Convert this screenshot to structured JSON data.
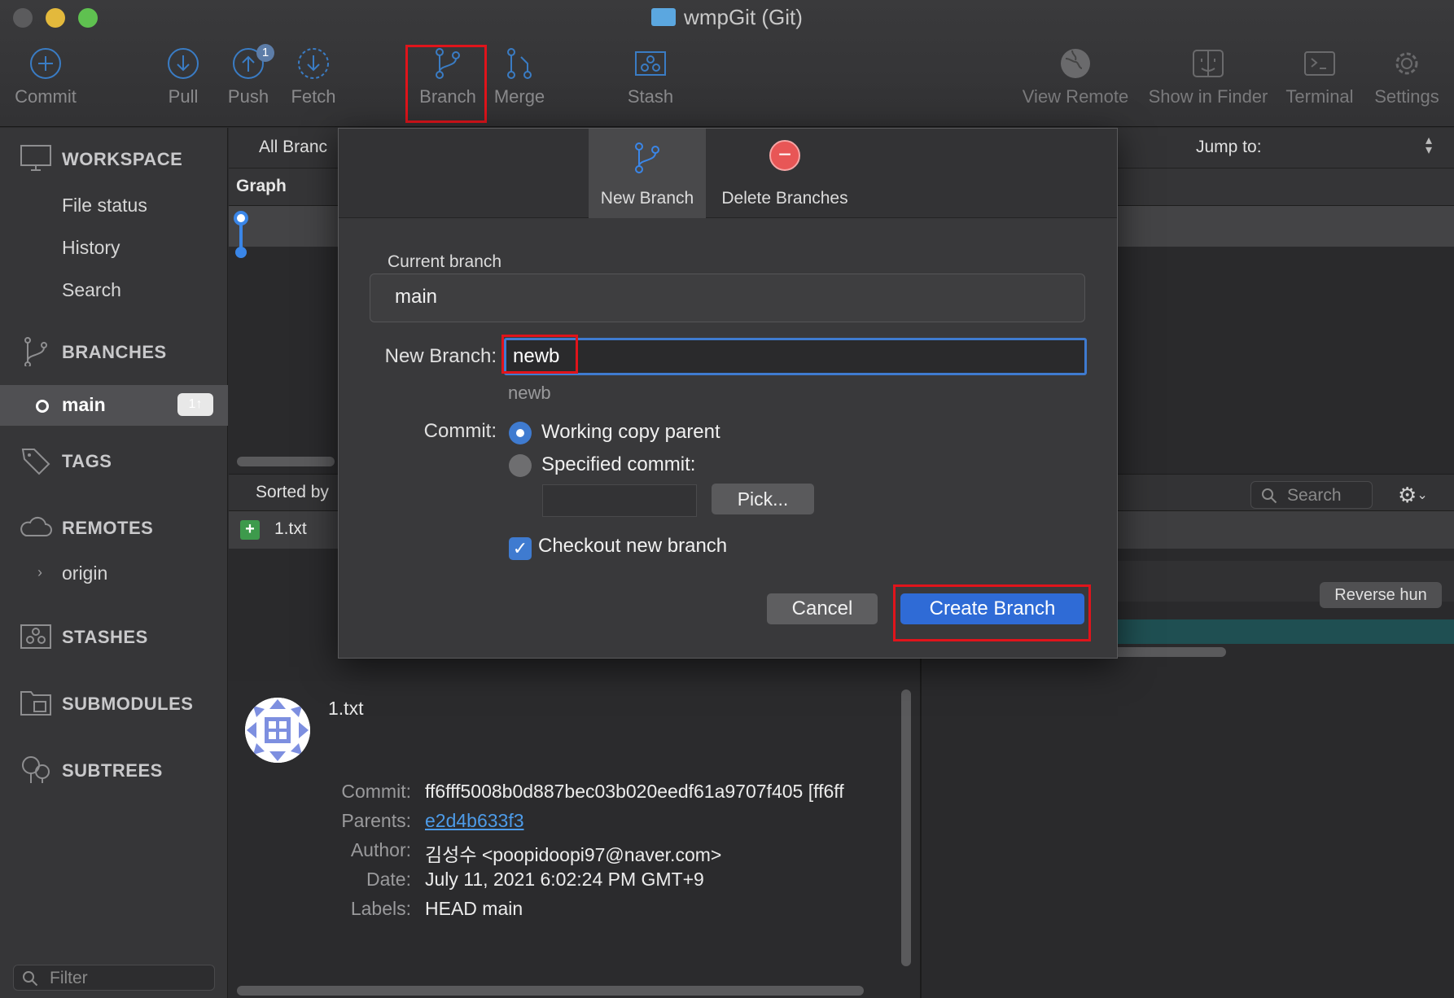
{
  "window": {
    "title": "wmpGit (Git)"
  },
  "toolbar": {
    "commit": "Commit",
    "pull": "Pull",
    "push": "Push",
    "push_badge": "1",
    "fetch": "Fetch",
    "branch": "Branch",
    "merge": "Merge",
    "stash": "Stash",
    "view_remote": "View Remote",
    "show_in_finder": "Show in Finder",
    "terminal": "Terminal",
    "settings": "Settings"
  },
  "sidebar": {
    "workspace": "WORKSPACE",
    "file_status": "File status",
    "history": "History",
    "search": "Search",
    "branches": "BRANCHES",
    "main_branch": "main",
    "main_badge": "1↑",
    "tags": "TAGS",
    "remotes": "REMOTES",
    "origin": "origin",
    "stashes": "STASHES",
    "submodules": "SUBMODULES",
    "subtrees": "SUBTREES",
    "filter_placeholder": "Filter"
  },
  "content": {
    "all_branches": "All Branc",
    "jump_to": "Jump to:",
    "graph_header": "Graph",
    "sorted_by": "Sorted by",
    "search_placeholder": "Search",
    "file_name": "1.txt",
    "reverse_hunk": "Reverse hun"
  },
  "details": {
    "file": "1.txt",
    "commit_label": "Commit:",
    "commit_value": "ff6fff5008b0d887bec03b020eedf61a9707f405 [ff6ff",
    "parents_label": "Parents:",
    "parents_value": "e2d4b633f3",
    "author_label": "Author:",
    "author_value": "김성수 <poopidoopi97@naver.com>",
    "date_label": "Date:",
    "date_value": "July 11, 2021 6:02:24 PM GMT+9",
    "labels_label": "Labels:",
    "labels_value": "HEAD main"
  },
  "dialog": {
    "tab_new": "New Branch",
    "tab_delete": "Delete Branches",
    "current_branch_label": "Current branch",
    "current_branch_value": "main",
    "new_branch_label": "New Branch:",
    "new_branch_value": "newb",
    "new_branch_hint": "newb",
    "commit_label": "Commit:",
    "option_working_copy": "Working copy parent",
    "option_specified": "Specified commit:",
    "pick": "Pick...",
    "checkout_label": "Checkout new branch",
    "checkout_checked": true,
    "cancel": "Cancel",
    "create": "Create Branch"
  },
  "colors": {
    "accent": "#2f6bd6",
    "highlight": "#e0141b",
    "graph_line": "#3a86e8",
    "added_file": "#3d9a4c"
  }
}
